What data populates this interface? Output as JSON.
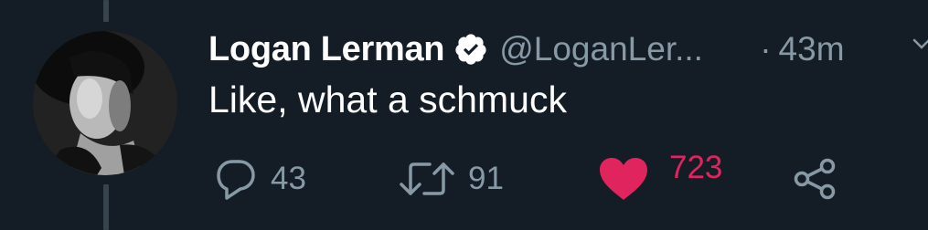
{
  "tweet": {
    "display_name": "Logan Lerman",
    "verified": true,
    "handle": "@LoganLer...",
    "separator": "·",
    "timestamp": "43m",
    "text": "Like, what a schmuck"
  },
  "actions": {
    "reply_count": "43",
    "retweet_count": "91",
    "like_count": "723",
    "liked": true
  },
  "colors": {
    "background": "#141d26",
    "text_primary": "#ffffff",
    "text_secondary": "#8899a6",
    "like_active": "#e0245e",
    "thread_line": "#38444d"
  },
  "icons": {
    "verified": "verified-badge-icon",
    "caret": "chevron-down-icon",
    "reply": "reply-bubble-icon",
    "retweet": "retweet-arrows-icon",
    "like": "heart-icon",
    "share": "share-icon"
  }
}
